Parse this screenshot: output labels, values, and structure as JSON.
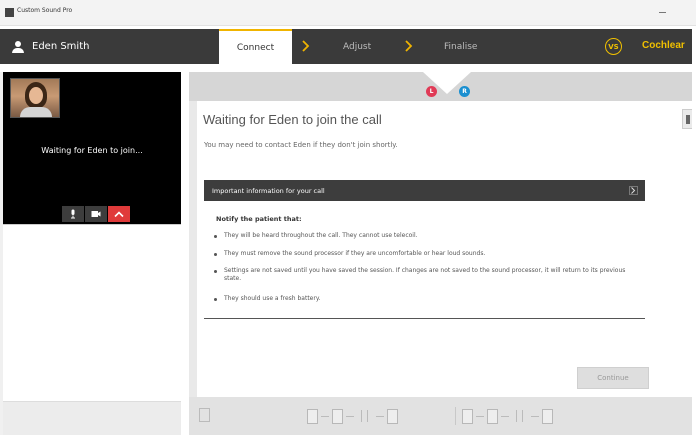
{
  "window": {
    "title": "Custom Sound Pro"
  },
  "header": {
    "user_name": "Eden Smith",
    "steps": [
      {
        "label": "Connect",
        "active": true
      },
      {
        "label": "Adjust",
        "active": false
      },
      {
        "label": "Finalise",
        "active": false
      }
    ],
    "user_initials": "VS",
    "brand": "Cochlear"
  },
  "call": {
    "waiting_text": "Waiting for Eden to join..."
  },
  "indicators": {
    "left_label": "L",
    "right_label": "R",
    "colors": {
      "left": "#e03a56",
      "right": "#1a8fd0"
    }
  },
  "main": {
    "title": "Waiting for Eden to join the call",
    "subtitle": "You may need to contact Eden if they don't join shortly.",
    "info_bar_label": "Important information for your call",
    "notify_title": "Notify the patient that:",
    "bullets": [
      "They will be heard throughout the call. They cannot use telecoil.",
      "They must remove the sound processor if they are uncomfortable or hear loud sounds.",
      "Settings are not saved until you have saved the session. If changes are not saved to the sound processor, it will return to its previous state.",
      "They should use a fresh battery."
    ],
    "continue_label": "Continue"
  },
  "colors": {
    "accent": "#f0b400",
    "header_bg": "#3a3a3a",
    "hangup": "#e03a3a"
  }
}
